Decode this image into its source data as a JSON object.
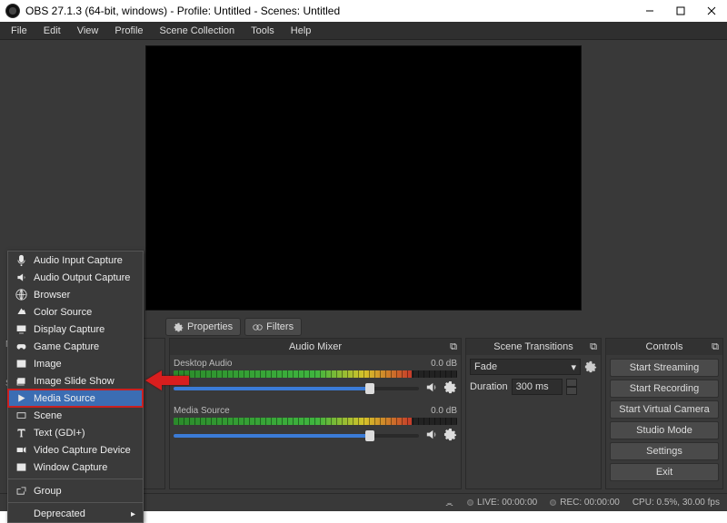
{
  "title": "OBS 27.1.3 (64-bit, windows) - Profile: Untitled - Scenes: Untitled",
  "menu": [
    "File",
    "Edit",
    "View",
    "Profile",
    "Scene Collection",
    "Tools",
    "Help"
  ],
  "toolbar": {
    "properties": "Properties",
    "filters": "Filters"
  },
  "leftPanels": {
    "no": "No",
    "sc": "Sc"
  },
  "mixer": {
    "title": "Audio Mixer",
    "channels": [
      {
        "name": "Desktop Audio",
        "db": "0.0 dB",
        "meterPct": 84,
        "volPct": 80
      },
      {
        "name": "Media Source",
        "db": "0.0 dB",
        "meterPct": 84,
        "volPct": 80
      }
    ]
  },
  "transitions": {
    "title": "Scene Transitions",
    "current": "Fade",
    "durationLabel": "Duration",
    "duration": "300 ms"
  },
  "controls": {
    "title": "Controls",
    "buttons": [
      "Start Streaming",
      "Start Recording",
      "Start Virtual Camera",
      "Studio Mode",
      "Settings",
      "Exit"
    ]
  },
  "status": {
    "live": "LIVE: 00:00:00",
    "rec": "REC: 00:00:00",
    "cpu": "CPU: 0.5%, 30.00 fps"
  },
  "ctx": {
    "items": [
      "Audio Input Capture",
      "Audio Output Capture",
      "Browser",
      "Color Source",
      "Display Capture",
      "Game Capture",
      "Image",
      "Image Slide Show",
      "Media Source",
      "Scene",
      "Text (GDI+)",
      "Video Capture Device",
      "Window Capture"
    ],
    "group": "Group",
    "deprecated": "Deprecated",
    "highlight": "Media Source"
  }
}
